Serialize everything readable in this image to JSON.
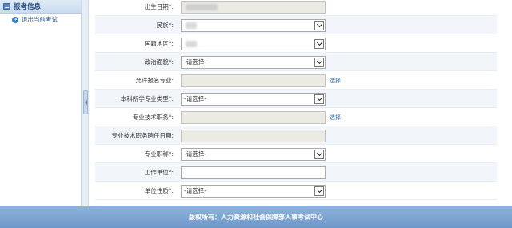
{
  "sidebar": {
    "header": "报考信息",
    "items": [
      {
        "label": "退出当前考试"
      }
    ]
  },
  "form": {
    "placeholder_select": "-请选择-",
    "select_link": "选择",
    "rows": [
      {
        "label": "出生日期*:"
      },
      {
        "label": "民族*:"
      },
      {
        "label": "国籍地区*:"
      },
      {
        "label": "政治面貌*:"
      },
      {
        "label": "允许报名专业:"
      },
      {
        "label": "本科所学专业类型*:"
      },
      {
        "label": "专业技术职务*:"
      },
      {
        "label": "专业技术职务聘任日期:"
      },
      {
        "label": "专业职称*:"
      },
      {
        "label": "工作单位*:"
      },
      {
        "label": "单位性质*:"
      }
    ]
  },
  "footer": {
    "text": "版权所有：人力资源和社会保障部人事考试中心"
  }
}
